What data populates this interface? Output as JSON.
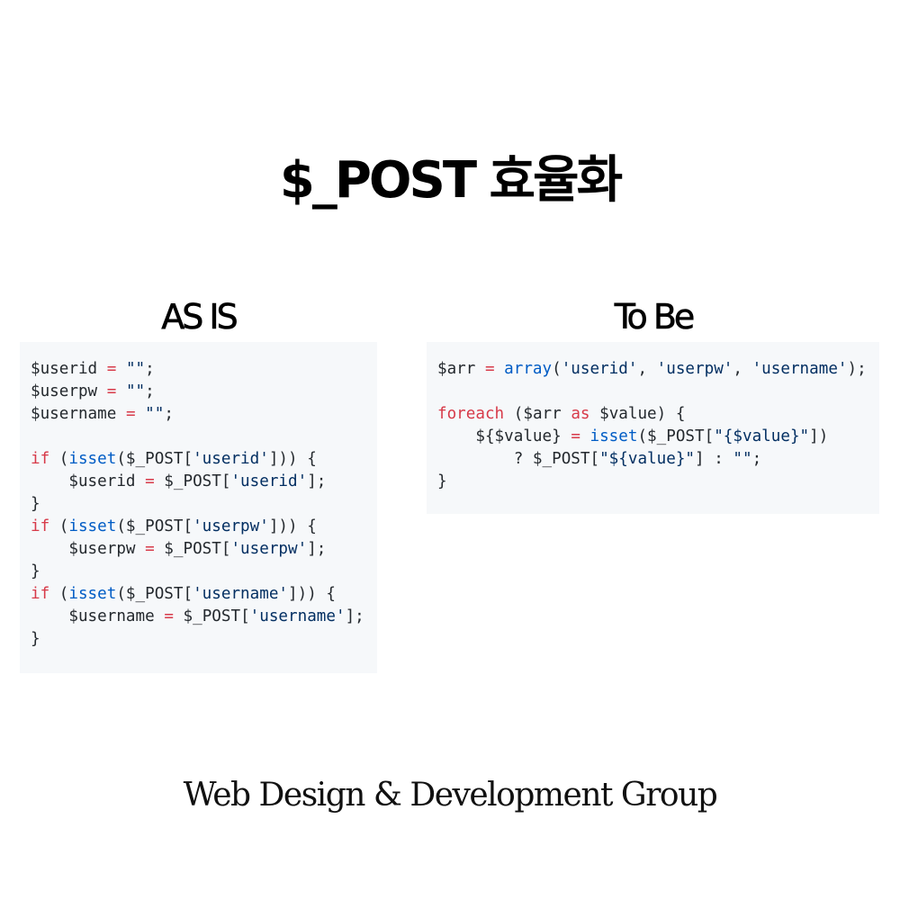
{
  "title": "$_POST 효율화",
  "as_is": {
    "heading": "AS IS",
    "code_lines": [
      "$userid = \"\";",
      "$userpw = \"\";",
      "$username = \"\";",
      "",
      "if (isset($_POST['userid'])) {",
      "    $userid = $_POST['userid'];",
      "}",
      "if (isset($_POST['userpw'])) {",
      "    $userpw = $_POST['userpw'];",
      "}",
      "if (isset($_POST['username'])) {",
      "    $username = $_POST['username'];",
      "}"
    ]
  },
  "to_be": {
    "heading": "To Be",
    "code_lines": [
      "$arr = array('userid', 'userpw', 'username');",
      "",
      "foreach ($arr as $value) {",
      "    ${$value} = isset($_POST[\"{$value}\"])",
      "        ? $_POST[\"${value}\"] : \"\";",
      "}"
    ]
  },
  "footer": "Web Design & Development Group"
}
